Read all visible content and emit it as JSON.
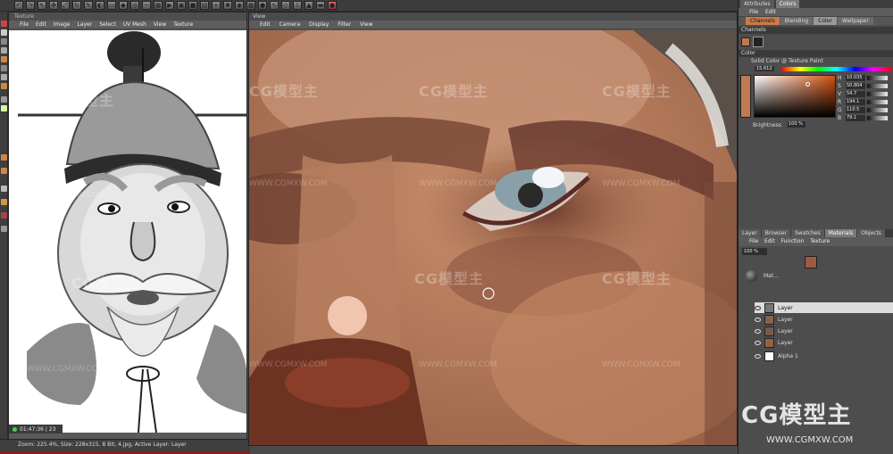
{
  "app": {
    "texture_panel_title": "Texture",
    "viewport_title": "View"
  },
  "texture_menu": [
    "File",
    "Edit",
    "Image",
    "Layer",
    "Select",
    "UV Mesh",
    "View",
    "Texture"
  ],
  "viewport_menu": [
    "Edit",
    "Camera",
    "Display",
    "Filter",
    "View"
  ],
  "timer": "01:47:36 | 23",
  "status_text": "Zoom: 225.4%, Size: 228x315, 8 Bit, 4.jpg, Active Layer: Layer",
  "right_panel": {
    "top_tabs": [
      "Attributes",
      "Colors"
    ],
    "menu": [
      "File",
      "Edit"
    ],
    "channel_tabs": [
      "Channels",
      "Blending",
      "Color",
      "Wallpaper"
    ],
    "channel_tab_selected": "Channels",
    "channels_label": "Channels",
    "color_section": "Color",
    "color_mode": "Solid Color @ Texture Paint",
    "hex_label": "15.612",
    "sliders": [
      {
        "label": "H",
        "value": "10.035"
      },
      {
        "label": "S",
        "value": "50.804"
      },
      {
        "label": "V",
        "value": "54.7"
      },
      {
        "label": "R",
        "value": "194.1"
      },
      {
        "label": "G",
        "value": "110.5"
      },
      {
        "label": "B",
        "value": "79.1"
      }
    ],
    "brightness_label": "Brightness",
    "brightness_value": "100 %",
    "current_color": "#c07a52",
    "layer_tabs": [
      "Layer",
      "Browser",
      "Swatches",
      "Materials",
      "Objects"
    ],
    "layer_menu": [
      "File",
      "Edit",
      "Function",
      "Texture"
    ],
    "layer_mode": "100 %",
    "layers": [
      {
        "name": "Layer",
        "selected": true
      },
      {
        "name": "Layer",
        "selected": false
      },
      {
        "name": "Layer",
        "selected": false
      },
      {
        "name": "Layer",
        "selected": false
      },
      {
        "name": "Alpha 1",
        "selected": false
      }
    ],
    "material_name": "Mat..."
  },
  "watermark": {
    "logo": "CG模型主",
    "url": "WWW.CGMXW.COM"
  },
  "colors": {
    "accent": "#c97a4a",
    "status_red": "#8c1a1a",
    "skin": "#b07656"
  }
}
